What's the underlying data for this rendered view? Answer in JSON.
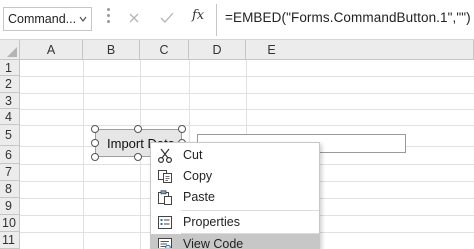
{
  "formula_bar": {
    "name_box": "Command...",
    "cancel_icon": "cancel-x-icon",
    "enter_icon": "enter-check-icon",
    "function_label": "fx",
    "formula": "=EMBED(\"Forms.CommandButton.1\",\"\")"
  },
  "columns": [
    "A",
    "B",
    "C",
    "D",
    "E"
  ],
  "rows": [
    "1",
    "2",
    "3",
    "4",
    "5",
    "6",
    "7",
    "8",
    "9",
    "10",
    "11"
  ],
  "command_button": {
    "label": "Import Data"
  },
  "context_menu": {
    "items": [
      {
        "label": "Cut",
        "icon": "scissors-icon"
      },
      {
        "label": "Copy",
        "icon": "copy-icon"
      },
      {
        "label": "Paste",
        "icon": "paste-icon"
      },
      {
        "label": "Properties",
        "icon": "properties-icon"
      },
      {
        "label": "View Code",
        "icon": "view-code-icon"
      }
    ],
    "highlighted": "View Code"
  },
  "colors": {
    "header_bg": "#ececec",
    "gridline": "#e1e1e1",
    "menu_highlight": "#c7c7c7",
    "button_face": "#e6e6e6"
  }
}
